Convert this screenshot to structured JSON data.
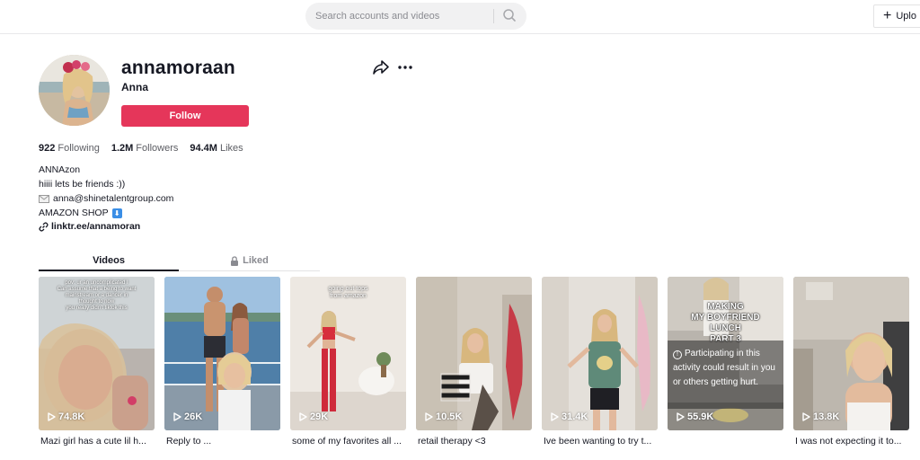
{
  "topbar": {
    "search_placeholder": "Search accounts and videos",
    "upload_label": "Uplo"
  },
  "profile": {
    "username": "annamoraan",
    "nickname": "Anna",
    "follow_label": "Follow",
    "stats": {
      "following_count": "922",
      "following_label": "Following",
      "followers_count": "1.2M",
      "followers_label": "Followers",
      "likes_count": "94.4M",
      "likes_label": "Likes"
    },
    "bio": {
      "line1": "ANNAzon",
      "line2": "hiiii lets be friends :))",
      "email": "anna@shinetalentgroup.com",
      "shop": "AMAZON SHOP"
    },
    "link": "linktr.ee/annamoran"
  },
  "tabs": {
    "videos": "Videos",
    "liked": "Liked"
  },
  "videos": [
    {
      "views": "74.8K",
      "caption": "Mazi girl has a cute lil h...",
      "overlay": "pov: ur an uncomplicated I / Can assume that a being to want / mainstream or a dancer in / thought to now / you really didn't tiktok this"
    },
    {
      "views": "26K",
      "caption": "Reply to ..."
    },
    {
      "views": "29K",
      "caption": "some of my favorites all ...",
      "overlay": "going out tops / from amazon"
    },
    {
      "views": "10.5K",
      "caption": "retail therapy <3"
    },
    {
      "views": "31.4K",
      "caption": "Ive been wanting to try t..."
    },
    {
      "views": "55.9K",
      "caption": "",
      "title_line1": "MAKING",
      "title_line2": "MY BOYFRIEND",
      "title_line3": "LUNCH",
      "title_line4": "PART 3",
      "warning": "Participating in this activity could result in you or others getting hurt."
    },
    {
      "views": "13.8K",
      "caption": "I was not expecting it to..."
    }
  ],
  "colors": {
    "follow": "#e5365a",
    "text": "#161823",
    "muted": "#8a8b91"
  }
}
